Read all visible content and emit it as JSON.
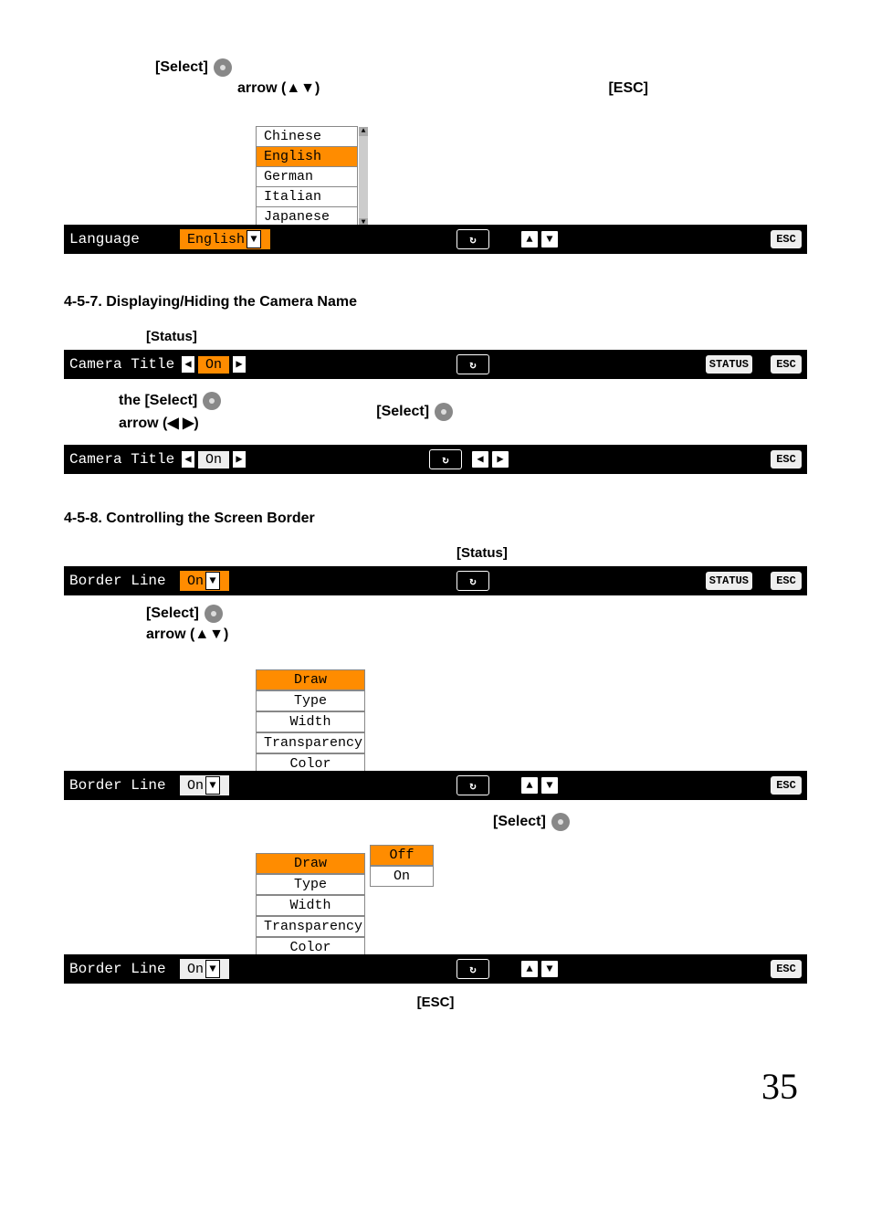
{
  "page_number": "35",
  "sections": {
    "s1": {
      "pre": {
        "select_label": "[Select]",
        "arrow_label": "arrow (▲▼)",
        "esc_label": "[ESC]"
      },
      "row": {
        "label": "Language",
        "value": "English",
        "options": [
          "Chinese",
          "English",
          "German",
          "Italian",
          "Japanese"
        ]
      }
    },
    "s2": {
      "title": "4-5-7. Displaying/Hiding the Camera Name",
      "pre": {
        "status": "[Status]"
      },
      "row1": {
        "label": "Camera Title",
        "value": "On",
        "status_btn": "STATUS",
        "esc_btn": "ESC"
      },
      "mid": {
        "the_select": "the [Select]",
        "arrow_lr": "arrow (◀ ▶)",
        "select": "[Select]"
      },
      "row2": {
        "label": "Camera Title",
        "value": "On",
        "esc_btn": "ESC"
      }
    },
    "s3": {
      "title": "4-5-8. Controlling the Screen Border",
      "pre": {
        "status": "[Status]"
      },
      "row1": {
        "label": "Border Line",
        "value": "On",
        "status_btn": "STATUS",
        "esc_btn": "ESC"
      },
      "mid1": {
        "select": "[Select]",
        "arrow": "arrow (▲▼)"
      },
      "menu": [
        "Draw",
        "Type",
        "Width",
        "Transparency",
        "Color"
      ],
      "row2": {
        "label": "Border Line",
        "value": "On",
        "esc_btn": "ESC"
      },
      "mid2": {
        "select": "[Select]"
      },
      "side_menu": [
        "Off",
        "On"
      ],
      "row3": {
        "label": "Border Line",
        "value": "On",
        "esc_btn": "ESC"
      },
      "tail": {
        "esc": "[ESC]"
      }
    }
  },
  "icons": {
    "refresh": "↻",
    "up": "▲",
    "down": "▼",
    "left": "◀",
    "right": "▶",
    "esc": "ESC"
  }
}
